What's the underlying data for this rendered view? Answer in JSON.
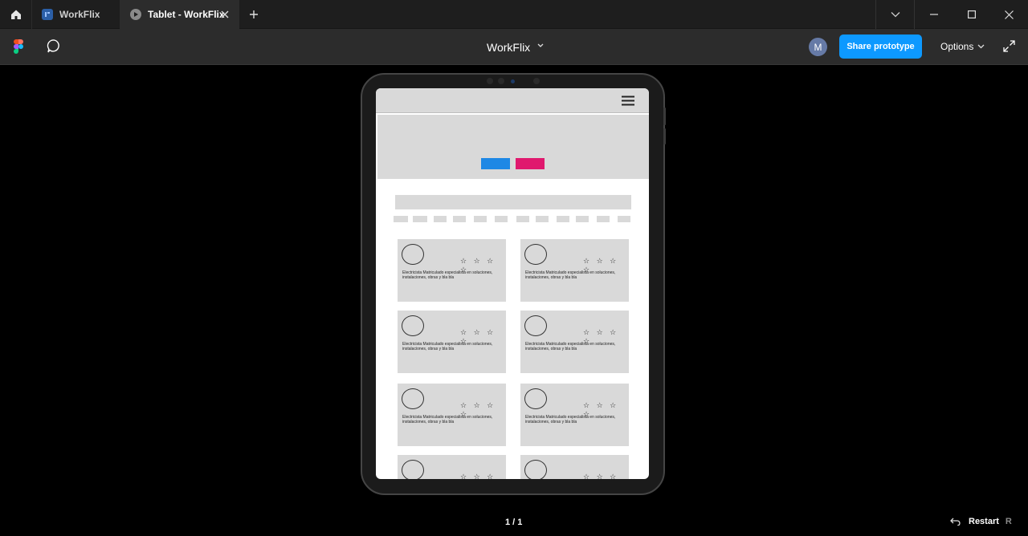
{
  "tabs": [
    {
      "label": "WorkFlix",
      "type": "file"
    },
    {
      "label": "Tablet - WorkFlix",
      "type": "prototype"
    }
  ],
  "toolbar": {
    "file_title": "WorkFlix",
    "avatar_initial": "M",
    "share_label": "Share prototype",
    "options_label": "Options"
  },
  "prototype": {
    "cards": [
      {
        "stars": "☆ ☆ ☆ ☆",
        "text": "Electricista Matriculado especialista en soluciones, instalaciones, obras y bla bla"
      },
      {
        "stars": "☆ ☆ ☆ ☆",
        "text": "Electricista Matriculado especialista en soluciones, instalaciones, obras y bla bla"
      },
      {
        "stars": "☆ ☆ ☆ ☆",
        "text": "Electricista Matriculado especialista en soluciones, instalaciones, obras y bla bla"
      },
      {
        "stars": "☆ ☆ ☆ ☆",
        "text": "Electricista Matriculado especialista en soluciones, instalaciones, obras y bla bla"
      },
      {
        "stars": "☆ ☆ ☆ ☆",
        "text": "Electricista Matriculado especialista en soluciones, instalaciones, obras y bla bla"
      },
      {
        "stars": "☆ ☆ ☆ ☆",
        "text": "Electricista Matriculado especialista en soluciones, instalaciones, obras y bla bla"
      },
      {
        "stars": "☆ ☆ ☆ ☆",
        "text": ""
      },
      {
        "stars": "☆ ☆ ☆ ☆",
        "text": ""
      }
    ],
    "colors": {
      "primary_button": "#1e88e5",
      "secondary_button": "#e0196e",
      "placeholder": "#d9d9d9"
    }
  },
  "footer": {
    "page_indicator": "1 / 1",
    "restart_label": "Restart",
    "restart_key": "R"
  },
  "colors": {
    "accent": "#0d99ff",
    "avatar": "#667aa6"
  }
}
